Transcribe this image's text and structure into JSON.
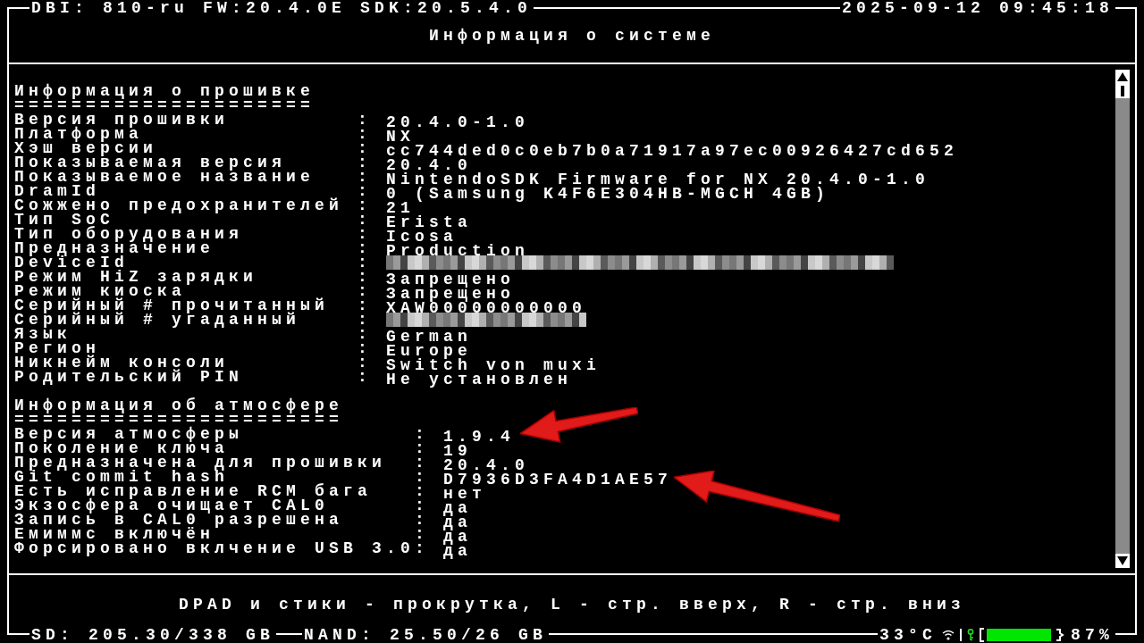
{
  "header": {
    "app_info": "DBI: 810-ru FW:20.4.0E SDK:20.5.4.0",
    "datetime": "2025-09-12 09:45:18"
  },
  "title": "Информация о системе",
  "sections": [
    {
      "heading": "Информация о прошивке",
      "underline": "=====================",
      "rows": [
        {
          "label": "Версия прошивки",
          "sep": ":",
          "value": "20.4.0-1.0"
        },
        {
          "label": "Платформа",
          "sep": ":",
          "value": "NX"
        },
        {
          "label": "Хэш версии",
          "sep": ":",
          "value": "cc744ded0c0eb7b0a71917a97ec00926427cd652"
        },
        {
          "label": "Показываемая версия",
          "sep": ":",
          "value": "20.4.0"
        },
        {
          "label": "Показываемое название",
          "sep": ":",
          "value": "NintendoSDK Firmware for NX 20.4.0-1.0"
        },
        {
          "label": "DramId",
          "sep": ":",
          "value": "0 (Samsung K4F6E304HB-MGCH 4GB)"
        },
        {
          "label": "Сожжено предохранителей",
          "sep": ":",
          "value": "21"
        },
        {
          "label": "Тип SoC",
          "sep": ":",
          "value": "Erista"
        },
        {
          "label": "Тип оборудования",
          "sep": ":",
          "value": "Icosa"
        },
        {
          "label": "Предназначение",
          "sep": ":",
          "value": "Production"
        },
        {
          "label": "DeviceId",
          "sep": ":",
          "redacted": true
        },
        {
          "label": "Режим HiZ зарядки",
          "sep": ":",
          "value": "Запрещено"
        },
        {
          "label": "Режим киоска",
          "sep": ":",
          "value": "Запрещено"
        },
        {
          "label": "Серийный # прочитанный",
          "sep": ":",
          "value": "XAW00000000000"
        },
        {
          "label": "Серийный # угаданный",
          "sep": ":",
          "redacted": true
        },
        {
          "label": "Язык",
          "sep": ":",
          "value": "German"
        },
        {
          "label": "Регион",
          "sep": ":",
          "value": "Europe"
        },
        {
          "label": "Никнейм консоли",
          "sep": ":",
          "value": "Switch von muxi"
        },
        {
          "label": "Родительский PIN",
          "sep": ":",
          "value": "Не установлен"
        }
      ]
    },
    {
      "heading": "Информация об атмосфере",
      "underline": "=======================",
      "rows": [
        {
          "label": "Версия атмосферы",
          "sep": ":",
          "value": "1.9.4",
          "arrow": true
        },
        {
          "label": "Поколение ключа",
          "sep": ":",
          "value": "19"
        },
        {
          "label": "Предназначена для прошивки",
          "sep": ":",
          "value": "20.4.0"
        },
        {
          "label": "Git commit hash",
          "sep": ":",
          "value": "D7936D3FA4D1AE57",
          "arrow": true
        },
        {
          "label": "Есть исправление RCM бага",
          "sep": ":",
          "value": "нет"
        },
        {
          "label": "Экзосфера очищает CAL0",
          "sep": ":",
          "value": "да"
        },
        {
          "label": "Запись в CAL0 разрешена",
          "sep": ":",
          "value": "да"
        },
        {
          "label": "Емиммс включён",
          "sep": ":",
          "value": "да"
        },
        {
          "label": "Форсировано вклчение USB 3.0",
          "sep": ":",
          "value": "да"
        }
      ]
    }
  ],
  "hint": "DPAD и стики - прокрутка, L - стр. вверх, R - стр. вниз",
  "status_bar": {
    "sd": "SD: 205.30/338 GB",
    "nand": "NAND: 25.50/26 GB",
    "temperature": "33°C",
    "battery": "87%"
  }
}
